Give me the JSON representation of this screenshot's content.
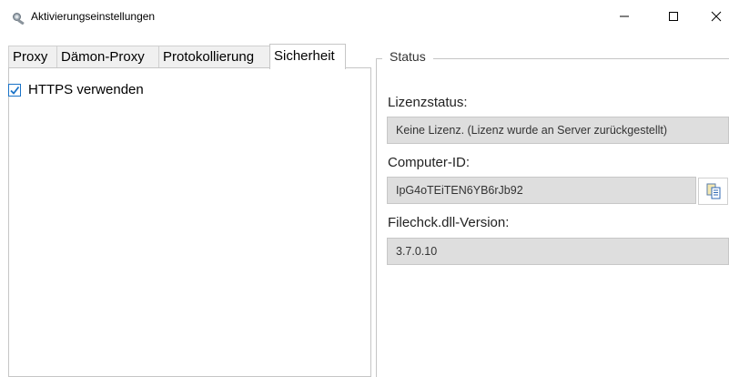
{
  "window": {
    "title": "Aktivierungseinstellungen",
    "icon": "magnifier-key-icon",
    "controls": {
      "minimize": "–",
      "maximize": "□",
      "close": "✕"
    }
  },
  "tabs": [
    {
      "label": "Proxy",
      "active": false
    },
    {
      "label": "Dämon-Proxy",
      "active": false
    },
    {
      "label": "Protokollierung",
      "active": false
    },
    {
      "label": "Sicherheit",
      "active": true
    }
  ],
  "security": {
    "https_checkbox_label": "HTTPS verwenden",
    "https_checked": true
  },
  "status": {
    "group_title": "Status",
    "license_label": "Lizenzstatus:",
    "license_value": "Keine Lizenz. (Lizenz wurde an Server zurückgestellt)",
    "computer_id_label": "Computer-ID:",
    "computer_id_value": "IpG4oTEiTEN6YB6rJb92",
    "copy_icon": "copy-clipboard-icon",
    "dll_version_label": "Filechck.dll-Version:",
    "dll_version_value": "3.7.0.10"
  },
  "colors": {
    "accent": "#1a73c7",
    "field_background": "#dedede",
    "border": "#c6c6c6"
  }
}
